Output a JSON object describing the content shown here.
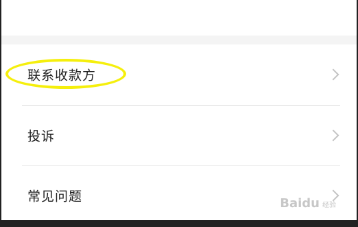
{
  "menu": {
    "items": [
      {
        "label": "联系收款方"
      },
      {
        "label": "投诉"
      },
      {
        "label": "常见问题"
      }
    ]
  },
  "watermark": {
    "text": "Baidu",
    "subtext": "经验"
  },
  "colors": {
    "highlight": "#f5ef0c",
    "chevron": "#c4c4c4"
  }
}
